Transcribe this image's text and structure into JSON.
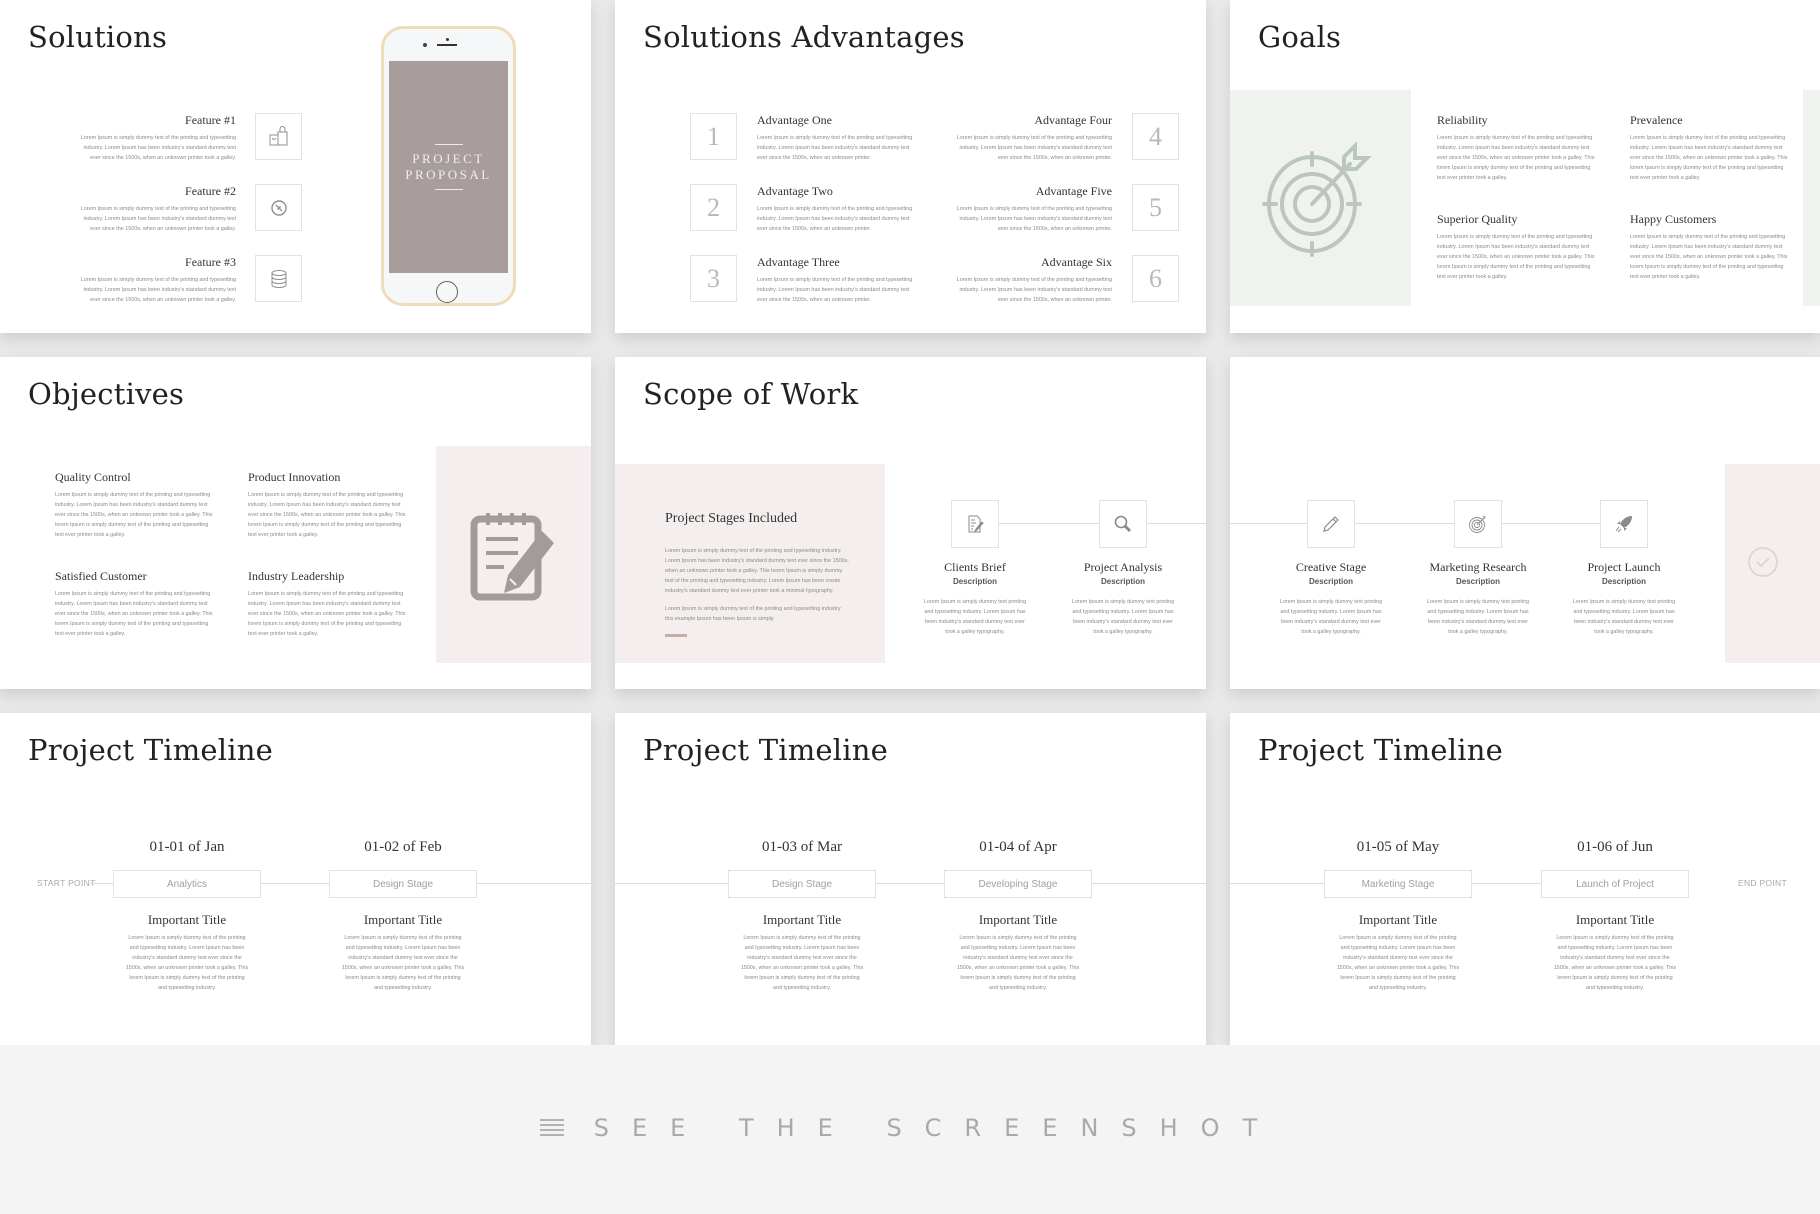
{
  "colors": {
    "background": "#f4f4f4",
    "phone_screen": "#a69d9c",
    "phone_frame": "#efdcbb",
    "goals_panel": "#f0f2f0",
    "goals_icon": "#bcc6c0",
    "pink_panel": "#f4efee",
    "notepad_icon": "#a39b9a",
    "accent_bar": "#c9ada2"
  },
  "slides": {
    "solutions": {
      "title": "Solutions",
      "features": [
        {
          "title": "Feature #1",
          "icon": "shopping-bags-icon",
          "text": [
            "Lorem Ipsum is simply dummy text of the printing and typesetting",
            "industry. Lorem Ipsum has been industry's standard dummy text",
            "ever since the 1500s, when an unknown printer took a galley."
          ]
        },
        {
          "title": "Feature #2",
          "icon": "compass-icon",
          "text": [
            "Lorem Ipsum is simply dummy text of the printing and typesetting",
            "industry. Lorem Ipsum has been industry's standard dummy text",
            "ever since the 1500s, when an unknown printer took a galley."
          ]
        },
        {
          "title": "Feature #3",
          "icon": "database-icon",
          "text": [
            "Lorem Ipsum is simply dummy text of the printing and typesetting",
            "industry. Lorem Ipsum has been industry's standard dummy text",
            "ever since the 1500s, when an unknown printer took a galley."
          ]
        }
      ],
      "phone_line1": "PROJECT",
      "phone_line2": "PROPOSAL"
    },
    "advantages": {
      "title": "Solutions Advantages",
      "items": [
        {
          "num": "1",
          "title": "Advantage One"
        },
        {
          "num": "2",
          "title": "Advantage Two"
        },
        {
          "num": "3",
          "title": "Advantage Three"
        },
        {
          "num": "4",
          "title": "Advantage Four"
        },
        {
          "num": "5",
          "title": "Advantage Five"
        },
        {
          "num": "6",
          "title": "Advantage Six"
        }
      ],
      "text": [
        "Lorem Ipsum is simply dummy text of the printing and typesetting",
        "industry. Lorem Ipsum has been industry's standard dummy text",
        "ever since the 1500s, when an unknown printer."
      ]
    },
    "goals": {
      "title": "Goals",
      "items": [
        {
          "title": "Reliability"
        },
        {
          "title": "Prevalence"
        },
        {
          "title": "Superior Quality"
        },
        {
          "title": "Happy Customers"
        }
      ],
      "text": [
        "Lorem Ipsum is simply dummy text of the printing and typesetting",
        "industry. Lorem Ipsum has been industry's standard dummy text",
        "ever since the 1500s, when an unknown printer took a galley. This",
        "lorem Ipsum is simply dummy text of the printing and typesetting",
        "text ever printer took a galley."
      ]
    },
    "objectives": {
      "title": "Objectives",
      "items": [
        {
          "title": "Quality Control"
        },
        {
          "title": "Product Innovation"
        },
        {
          "title": "Satisfied Customer"
        },
        {
          "title": "Industry Leadership"
        }
      ],
      "text": [
        "Lorem Ipsum is simply dummy text of the printing and typesetting",
        "industry. Lorem Ipsum has been industry's standard dummy text",
        "ever since the 1500s, when an unknown printer took a galley. This",
        "lorem Ipsum is simply dummy text of the printing and typesetting",
        "text ever printer took a galley."
      ]
    },
    "scope": {
      "title": "Scope of Work",
      "panel_title": "Project Stages Included",
      "panel_text1": [
        "Lorem Ipsum is simply dummy text of the printing and typesetting industry.",
        "Lorem Ipsum has been industry's standard dummy text ever since the 1500s,",
        "when an unknown printer took a galley. This lorem Ipsum is simply dummy",
        "text of the printing and typesetting industry. Lorem Ipsum has been create",
        "industry's standard dummy text ever printer took a minimal typography."
      ],
      "panel_text2": [
        "Lorem Ipsum is simply dummy text of the printing and typesetting industry",
        "this example Ipsum has been Ipsum is simply."
      ],
      "stages": [
        {
          "title": "Clients Brief",
          "icon": "document-edit-icon"
        },
        {
          "title": "Project Analysis",
          "icon": "magnifier-icon"
        },
        {
          "title": "Creative Stage",
          "icon": "pencil-icon"
        },
        {
          "title": "Marketing Research",
          "icon": "target-icon"
        },
        {
          "title": "Project Launch",
          "icon": "rocket-icon"
        }
      ],
      "stage_subtitle": "Description",
      "stage_text": [
        "Lorem Ipsum is simply dummy text printing",
        "and typesetting industry. Lorem Ipsum has",
        "been industry's standard dummy text ever",
        "took a galley typography."
      ]
    },
    "timeline": {
      "title": "Project Timeline",
      "start_label": "START POINT",
      "end_label": "END POINT",
      "milestones": [
        {
          "date": "01-01 of Jan",
          "stage": "Analytics"
        },
        {
          "date": "01-02 of Feb",
          "stage": "Design Stage"
        },
        {
          "date": "01-03 of Mar",
          "stage": "Design Stage"
        },
        {
          "date": "01-04 of Apr",
          "stage": "Developing Stage"
        },
        {
          "date": "01-05 of May",
          "stage": "Marketing Stage"
        },
        {
          "date": "01-06 of Jun",
          "stage": "Launch of Project"
        }
      ],
      "item_title": "Important Title",
      "item_text": [
        "Lorem Ipsum is simply dummy text of the printing",
        "and typesetting industry. Lorem Ipsum has been",
        "industry's standard dummy text ever since the",
        "1500s, when an unknown printer took a galley. This",
        "lorem Ipsum is simply dummy text of the printing",
        "and typesetting industry."
      ]
    }
  },
  "footer": {
    "icon": "hamburger-menu-icon",
    "label": "SEE THE SCREENSHOT"
  }
}
